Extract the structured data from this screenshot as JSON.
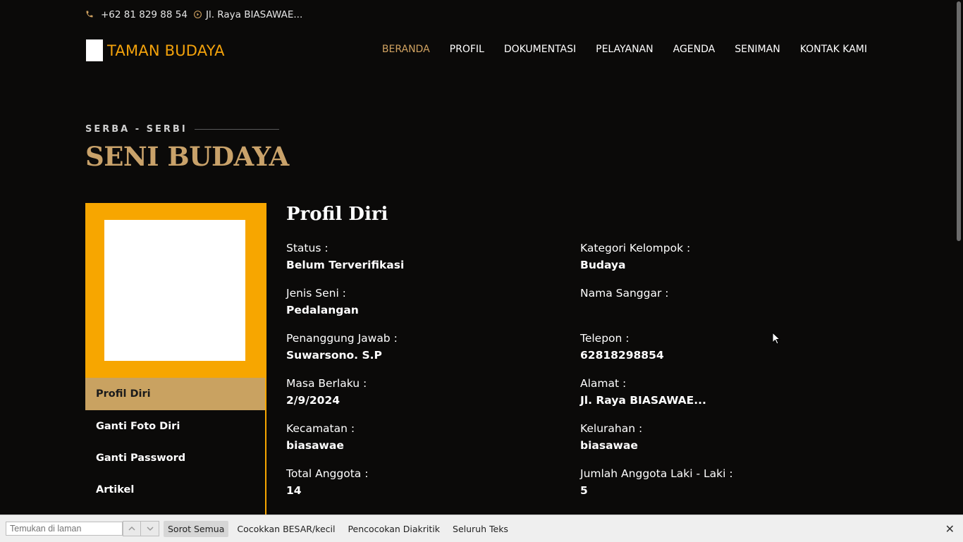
{
  "topbar": {
    "phone": "+62 81 829 88 54",
    "address": "Jl. Raya BIASAWAE..."
  },
  "brand": {
    "name": "TAMAN BUDAYA"
  },
  "nav": [
    {
      "label": "BERANDA",
      "active": true
    },
    {
      "label": "PROFIL"
    },
    {
      "label": "DOKUMENTASI"
    },
    {
      "label": "PELAYANAN"
    },
    {
      "label": "AGENDA"
    },
    {
      "label": "SENIMAN"
    },
    {
      "label": "KONTAK KAMI"
    }
  ],
  "hero": {
    "eyebrow": "SERBA - SERBI",
    "title": "SENI BUDAYA"
  },
  "sidebar": {
    "items": [
      {
        "label": "Profil Diri",
        "active": true
      },
      {
        "label": "Ganti Foto Diri"
      },
      {
        "label": "Ganti Password"
      },
      {
        "label": "Artikel"
      }
    ]
  },
  "profile": {
    "title": "Profil Diri",
    "fields": [
      {
        "label": "Status :",
        "value": "Belum Terverifikasi"
      },
      {
        "label": "Kategori Kelompok :",
        "value": "Budaya"
      },
      {
        "label": "Jenis Seni :",
        "value": "Pedalangan"
      },
      {
        "label": "Nama Sanggar :",
        "value": ""
      },
      {
        "label": "Penanggung Jawab :",
        "value": "Suwarsono. S.P"
      },
      {
        "label": "Telepon :",
        "value": "62818298854"
      },
      {
        "label": "Masa Berlaku :",
        "value": "2/9/2024"
      },
      {
        "label": "Alamat :",
        "value": "Jl. Raya BIASAWAE..."
      },
      {
        "label": "Kecamatan :",
        "value": "biasawae"
      },
      {
        "label": "Kelurahan :",
        "value": "biasawae"
      },
      {
        "label": "Total Anggota :",
        "value": "14"
      },
      {
        "label": "Jumlah Anggota Laki - Laki :",
        "value": "5"
      }
    ]
  },
  "findbar": {
    "placeholder": "Temukan di laman",
    "highlight_all": "Sorot Semua",
    "match_case": "Cocokkan BESAR/kecil",
    "match_diacritics": "Pencocokan Diakritik",
    "whole_words": "Seluruh Teks",
    "close": "✕"
  },
  "colors": {
    "accent": "#f7a600",
    "gold": "#c9a261",
    "background": "#0b0a09"
  }
}
